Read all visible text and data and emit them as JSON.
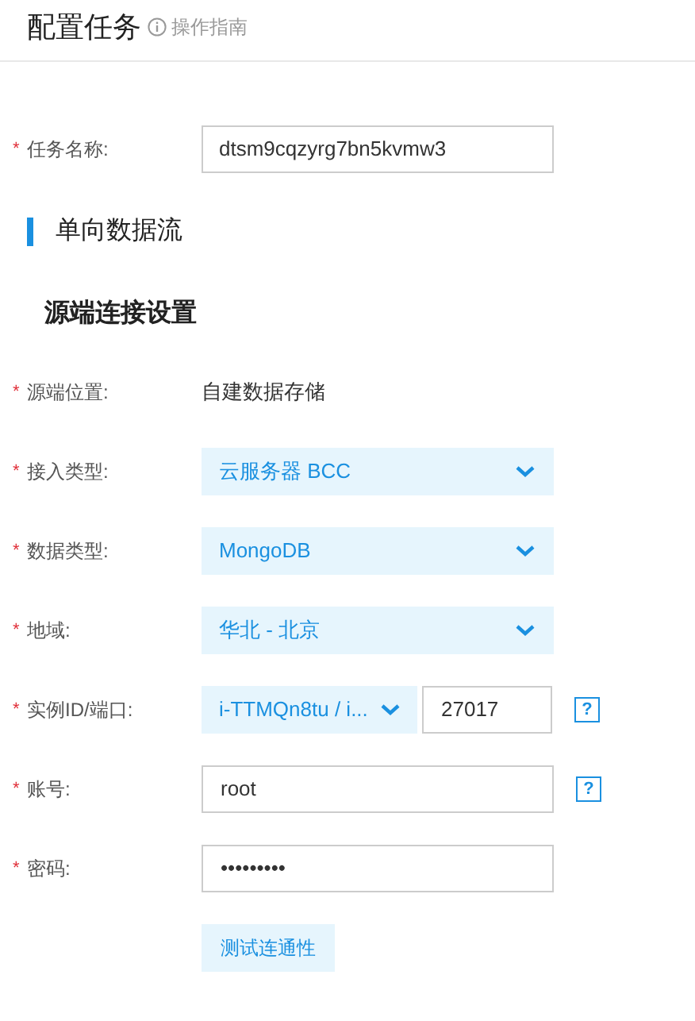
{
  "header": {
    "title": "配置任务",
    "guide": "操作指南"
  },
  "task_name": {
    "mark": "*",
    "label": "任务名称:",
    "value": "dtsm9cqzyrg7bn5kvmw3"
  },
  "section_title": "单向数据流",
  "subsection_title": "源端连接设置",
  "fields": [
    {
      "kind": "static",
      "mark": "*",
      "label": "源端位置:",
      "value": "自建数据存储"
    },
    {
      "kind": "select",
      "mark": "*",
      "label": "接入类型:",
      "value": "云服务器 BCC"
    },
    {
      "kind": "select",
      "mark": "*",
      "label": "数据类型:",
      "value": "MongoDB"
    },
    {
      "kind": "select",
      "mark": "*",
      "label": "地域:",
      "value": "华北 - 北京"
    },
    {
      "kind": "select_port",
      "mark": "*",
      "label": "实例ID/端口:",
      "value": "i-TTMQn8tu / i...",
      "port": "27017",
      "help": "?"
    },
    {
      "kind": "input",
      "mark": "*",
      "label": "账号:",
      "value": "root",
      "help": "?"
    },
    {
      "kind": "password",
      "mark": "*",
      "label": "密码:",
      "value": "•••••••••"
    }
  ],
  "button": "测试连通性"
}
